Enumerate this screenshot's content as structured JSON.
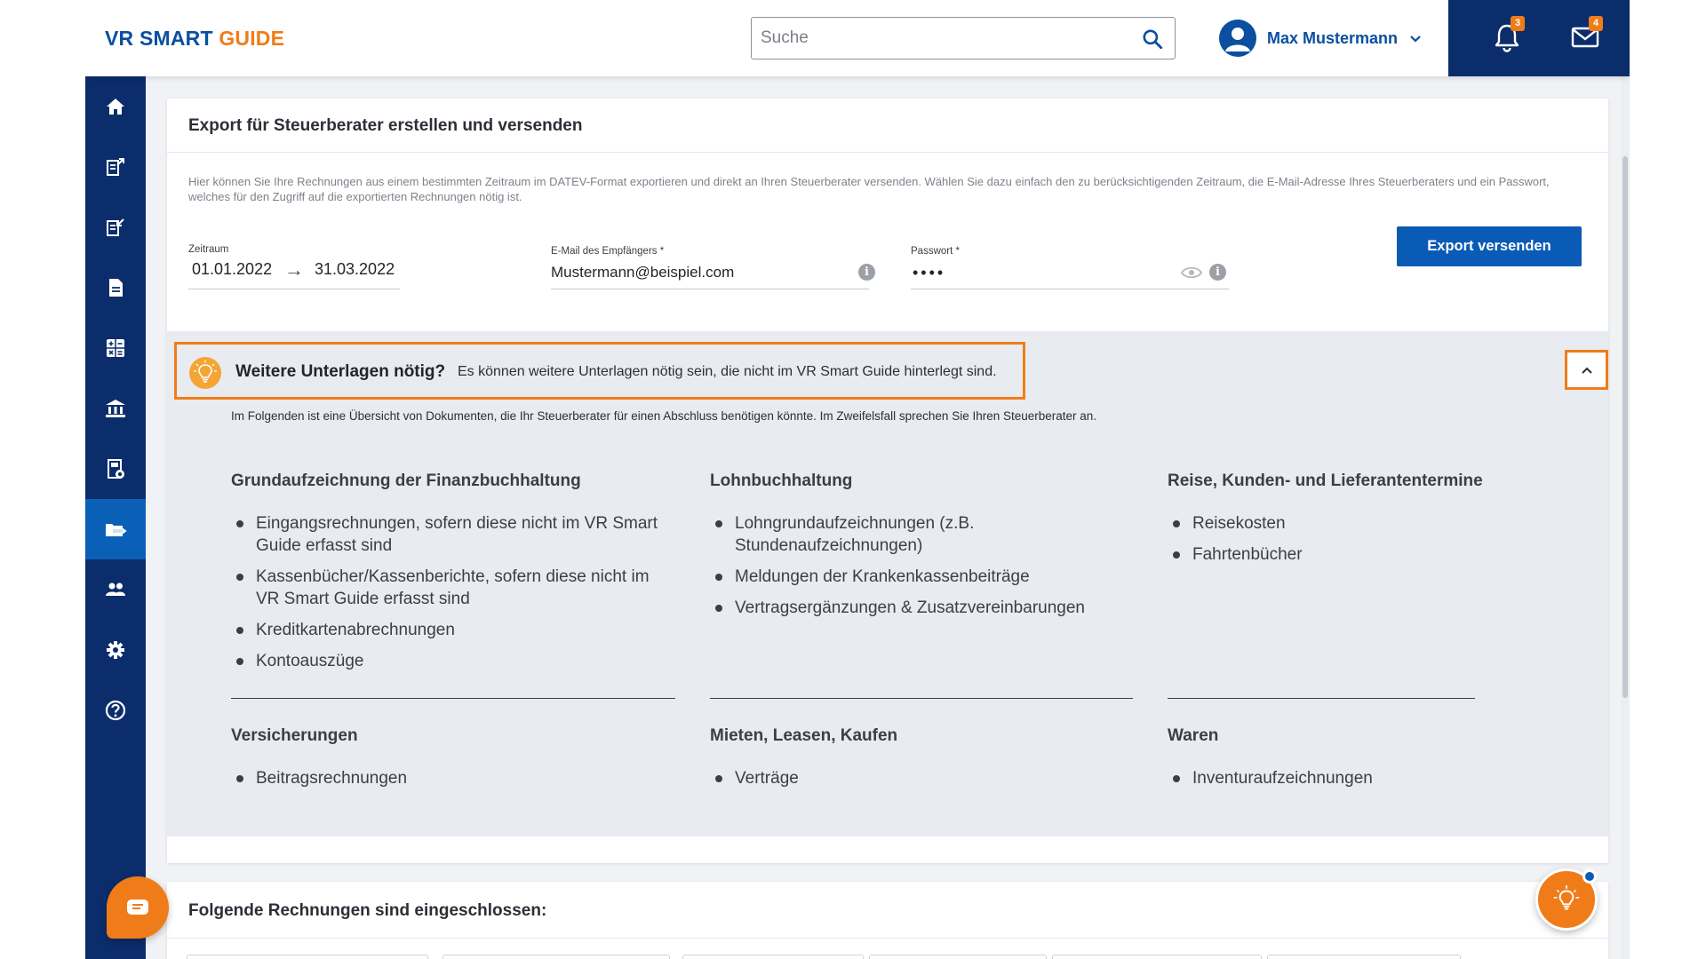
{
  "app": {
    "logo_part1": "VR SMART ",
    "logo_part2": "GUIDE",
    "brand_blue": "#0a4fa0",
    "brand_orange": "#f07c19",
    "nav_dark": "#0c2d6b"
  },
  "header": {
    "search_placeholder": "Suche",
    "user_name": "Max Mustermann",
    "notifications_count": "3",
    "messages_count": "4"
  },
  "sidebar": {
    "items": [
      {
        "name": "home",
        "icon": "home-icon"
      },
      {
        "name": "outgoing",
        "icon": "invoice-out-icon"
      },
      {
        "name": "incoming",
        "icon": "invoice-in-icon"
      },
      {
        "name": "documents",
        "icon": "document-icon"
      },
      {
        "name": "calculator",
        "icon": "calculator-icon"
      },
      {
        "name": "bank",
        "icon": "bank-icon"
      },
      {
        "name": "accounting",
        "icon": "ledger-icon"
      },
      {
        "name": "export",
        "icon": "folder-export-icon",
        "active": true
      },
      {
        "name": "contacts",
        "icon": "users-icon"
      },
      {
        "name": "settings",
        "icon": "gear-icon"
      },
      {
        "name": "help",
        "icon": "help-icon"
      }
    ]
  },
  "export": {
    "title": "Export für Steuerberater erstellen und versenden",
    "description": "Hier können Sie Ihre Rechnungen aus einem bestimmten Zeitraum im DATEV-Format exportieren und direkt an Ihren Steuerberater versenden. Wählen Sie dazu einfach den zu berücksichtigenden Zeitraum, die E-Mail-Adresse Ihres Steuerberaters und ein Passwort, welches für den Zugriff auf die exportierten Rechnungen nötig ist.",
    "period_label": "Zeitraum",
    "date_from": "01.01.2022",
    "arrow": "→",
    "date_to": "31.03.2022",
    "email_label": "E-Mail des Empfängers *",
    "email_value": "Mustermann@beispiel.com",
    "password_label": "Passwort *",
    "password_value": "••••",
    "submit_label": "Export versenden"
  },
  "hint": {
    "strong": "Weitere Unterlagen nötig?",
    "text": "Es können weitere Unterlagen nötig sein, die nicht im VR Smart Guide hinterlegt sind.",
    "intro": "Im Folgenden ist eine Übersicht von Dokumenten, die Ihr Steuerberater für einen Abschluss benötigen könnte. Im Zweifelsfall sprechen Sie Ihren Steuerberater an."
  },
  "columns_top": [
    {
      "title": "Grundaufzeichnung der Finanzbuchhaltung",
      "items": [
        "Eingangsrechnungen, sofern diese nicht im VR Smart Guide erfasst sind",
        "Kassenbücher/Kassenberichte, sofern diese nicht im VR Smart Guide erfasst sind",
        "Kreditkartenabrechnungen",
        "Kontoauszüge"
      ]
    },
    {
      "title": "Lohnbuchhaltung",
      "items": [
        "Lohngrundaufzeichnungen (z.B. Stundenaufzeichnungen)",
        "Meldungen der Krankenkassenbeiträge",
        "Vertragsergänzungen & Zusatzvereinbarungen"
      ]
    },
    {
      "title": "Reise, Kunden- und Lieferantentermine",
      "items": [
        "Reisekosten",
        "Fahrtenbücher"
      ]
    }
  ],
  "columns_bottom": [
    {
      "title": "Versicherungen",
      "items": [
        "Beitragsrechnungen"
      ]
    },
    {
      "title": "Mieten, Leasen, Kaufen",
      "items": [
        "Verträge"
      ]
    },
    {
      "title": "Waren",
      "items": [
        "Inventuraufzeichnungen"
      ]
    }
  ],
  "invoices": {
    "title": "Folgende Rechnungen sind eingeschlossen:"
  }
}
